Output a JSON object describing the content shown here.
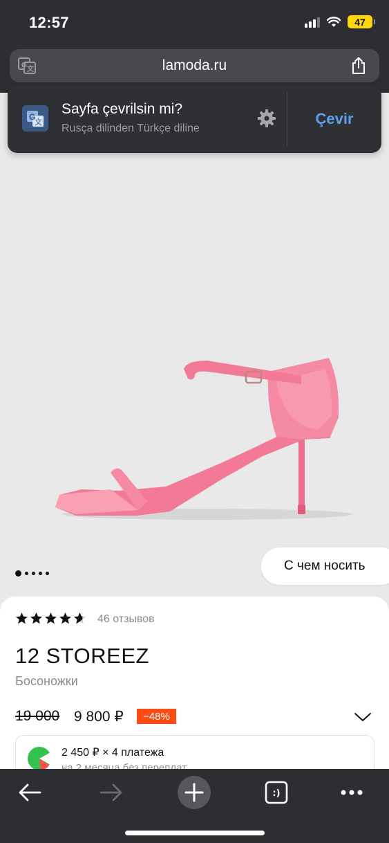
{
  "status_bar": {
    "time": "12:57",
    "battery": "47"
  },
  "browser": {
    "url": "lamoda.ru"
  },
  "translate_prompt": {
    "title": "Sayfa çevrilsin mi?",
    "subtitle": "Rusça dilinden Türkçe diline",
    "action": "Çevir"
  },
  "gallery": {
    "wear_with_label": "С чем носить",
    "slide_count": 5,
    "active_slide": 1
  },
  "product": {
    "rating": 4.5,
    "reviews": "46 отзывов",
    "brand": "12 STOREEZ",
    "type": "Босоножки",
    "old_price": "19 000",
    "new_price": "9 800 ₽",
    "discount": "−48%",
    "installments": {
      "main": "2 450 ₽ × 4 платежа",
      "sub": "на 2 месяца без переплат"
    }
  },
  "colors": {
    "accent_blue": "#5ea0ef",
    "discount_orange": "#fa4c14",
    "sandal_pink": "#f2879f"
  }
}
